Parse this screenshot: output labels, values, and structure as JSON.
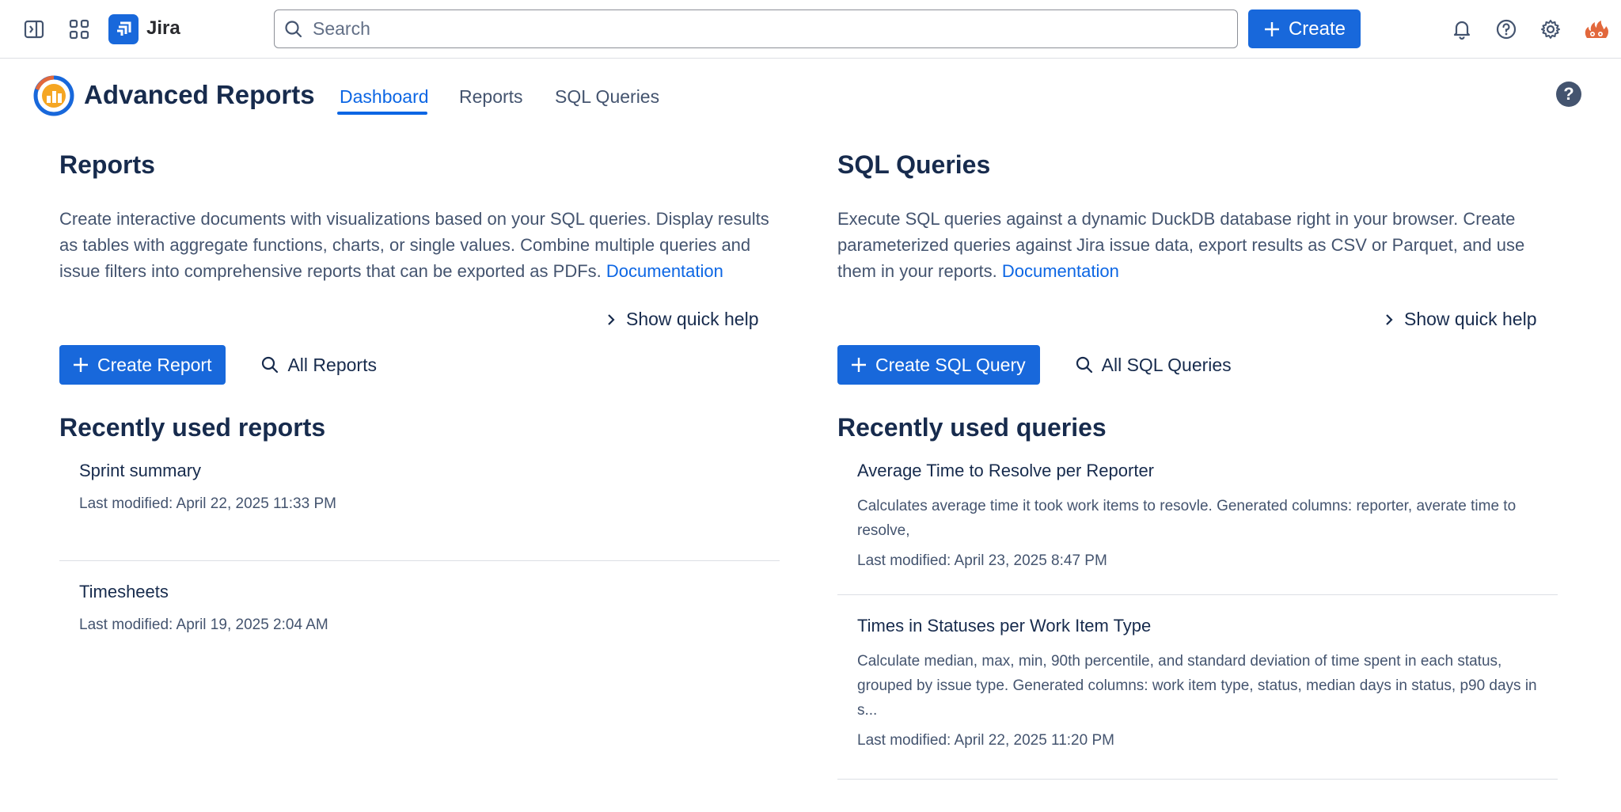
{
  "topnav": {
    "app_name": "Jira",
    "search_placeholder": "Search",
    "create_label": "Create"
  },
  "app": {
    "title": "Advanced Reports",
    "tabs": [
      {
        "label": "Dashboard",
        "active": true
      },
      {
        "label": "Reports",
        "active": false
      },
      {
        "label": "SQL Queries",
        "active": false
      }
    ],
    "help_glyph": "?"
  },
  "reports": {
    "title": "Reports",
    "description": "Create interactive documents with visualizations based on your SQL queries. Display results as tables with aggregate functions, charts, or single values. Combine multiple queries and issue filters into comprehensive reports that can be exported as PDFs.",
    "doc_link": "Documentation",
    "quick_help": "Show quick help",
    "create_button": "Create Report",
    "all_button": "All Reports",
    "recent_title": "Recently used reports",
    "items": [
      {
        "title": "Sprint summary",
        "meta": "Last modified: April 22, 2025 11:33 PM"
      },
      {
        "title": "Timesheets",
        "meta": "Last modified: April 19, 2025 2:04 AM"
      }
    ]
  },
  "queries": {
    "title": "SQL Queries",
    "description": "Execute SQL queries against a dynamic DuckDB database right in your browser. Create parameterized queries against Jira issue data, export results as CSV or Parquet, and use them in your reports.",
    "doc_link": "Documentation",
    "quick_help": "Show quick help",
    "create_button": "Create SQL Query",
    "all_button": "All SQL Queries",
    "recent_title": "Recently used queries",
    "items": [
      {
        "title": "Average Time to Resolve per Reporter",
        "desc": "Calculates average time it took work items to resovle. Generated columns: reporter, averate time to resolve,",
        "meta": "Last modified: April 23, 2025 8:47 PM"
      },
      {
        "title": "Times in Statuses per Work Item Type",
        "desc": "Calculate median, max, min, 90th percentile, and standard deviation of time spent in each status, grouped by issue type. Generated columns: work item type, status, median days in status, p90 days in s...",
        "meta": "Last modified: April 22, 2025 11:20 PM"
      }
    ]
  },
  "colors": {
    "brand_blue": "#1868db",
    "link_blue": "#0c66e4",
    "text": "#172b4d",
    "subtle_text": "#44546f"
  }
}
